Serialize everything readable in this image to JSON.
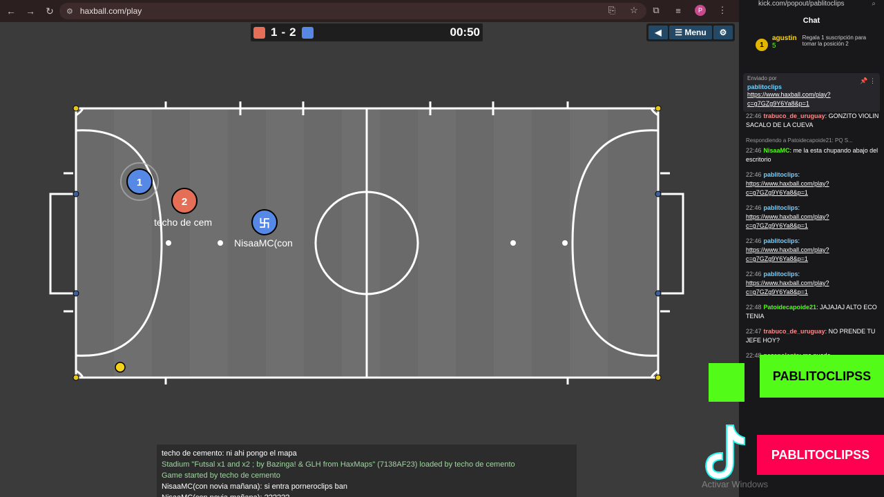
{
  "browser": {
    "url": "haxball.com/play"
  },
  "scoreboard": {
    "red_score": "1",
    "separator": "-",
    "blue_score": "2",
    "timer": "00:50"
  },
  "menu": {
    "menu_label": "Menu"
  },
  "players": {
    "red_number": "2",
    "red_name": "techo de cem",
    "blue_self_number": "1",
    "blue_other_name": "NisaaMC(con"
  },
  "game_chat": [
    {
      "text": "techo de cemento: ni ahi pongo el mapa",
      "style": "white"
    },
    {
      "text": "Stadium \"Futsal x1 and x2 ; by Bazinga! & GLH from HaxMaps\" (7138AF23) loaded by techo de cemento",
      "style": "green"
    },
    {
      "text": "Game started by techo de cemento",
      "style": "green"
    },
    {
      "text": "NisaaMC(con novia mañana): si entra porneroclips ban",
      "style": "white"
    },
    {
      "text": "NisaaMC(con novia mañana): ??????",
      "style": "white"
    }
  ],
  "side": {
    "url": "kick.com/popout/pablitoclips",
    "chat_title": "Chat",
    "gift_user": "agustin",
    "gift_count": "5",
    "gift_note": "Regala 1 suscripción para tomar la posición 2",
    "pinned_by": "Enviado por",
    "pinned_user": "pablitoclips",
    "pinned_link": "https://www.haxball.com/play?c=g7GZg9Y6Ya8&p=1"
  },
  "chat_messages": [
    {
      "time": "22:46",
      "user": "trabuco_de_uruguay",
      "text": "GONZITO VIOLIN SACALO DE LA CUEVA",
      "color": "u3"
    },
    {
      "reply": "Respondiendo a Patoidecapoide21: PQ S...",
      "time": "22:46",
      "user": "NisaaMC",
      "text": "me la esta chupando abajo del escritorio",
      "color": "u1"
    },
    {
      "time": "22:46",
      "user": "pablitoclips",
      "text": "https://www.haxball.com/play?c=g7GZg9Y6Ya8&p=1",
      "color": "u2",
      "link": true
    },
    {
      "time": "22:46",
      "user": "pablitoclips",
      "text": "https://www.haxball.com/play?c=g7GZg9Y6Ya8&p=1",
      "color": "u2",
      "link": true
    },
    {
      "time": "22:46",
      "user": "pablitoclips",
      "text": "https://www.haxball.com/play?c=g7GZg9Y6Ya8&p=1",
      "color": "u2",
      "link": true
    },
    {
      "time": "22:46",
      "user": "pablitoclips",
      "text": "https://www.haxball.com/play?c=g7GZg9Y6Ya8&p=1",
      "color": "u2",
      "link": true
    },
    {
      "time": "22:48",
      "user": "Patoidecapoide21",
      "text": "JAJAJAJ ALTO ECO TENIA",
      "color": "u1"
    },
    {
      "time": "22:47",
      "user": "trabuco_de_uruguay",
      "text": "NO PRENDE TU JEFE HOY?",
      "color": "u3"
    },
    {
      "time": "22:48",
      "user": "nazapolenta",
      "text": "me puedo",
      "color": "u4"
    }
  ],
  "overlays": {
    "kick_name": "PABLITOCLIPSS",
    "tiktok_name": "PABLITOCLIPSS",
    "watermark": "Activar Windows"
  },
  "colors": {
    "red_team": "#e56e56",
    "blue_team": "#5689e5",
    "kick_green": "#53fc18",
    "tiktok_pink": "#ff0050"
  }
}
